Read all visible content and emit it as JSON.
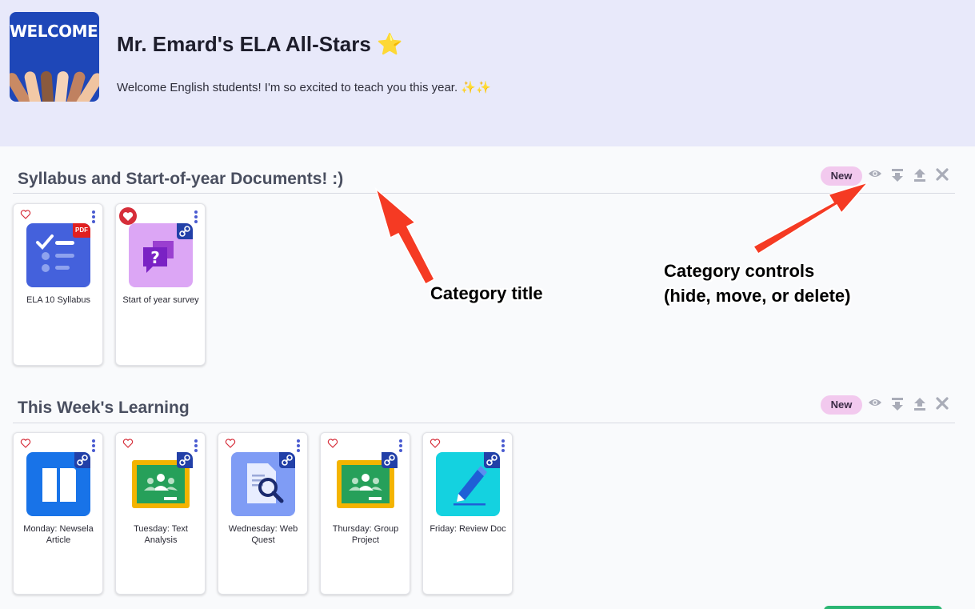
{
  "header": {
    "banner_text": "WELCOME!",
    "title": "Mr. Emard's ELA All-Stars ⭐",
    "description": "Welcome English students! I'm so excited to teach you this year. ✨✨"
  },
  "sections": [
    {
      "title": "Syllabus and Start-of-year Documents! :)",
      "new_label": "New",
      "items": [
        {
          "label": "ELA 10 Syllabus",
          "badge": "PDF"
        },
        {
          "label": "Start of year survey",
          "badge": "link"
        }
      ]
    },
    {
      "title": "This Week's Learning",
      "new_label": "New",
      "items": [
        {
          "label": "Monday: Newsela Article",
          "badge": "link"
        },
        {
          "label": "Tuesday: Text Analysis",
          "badge": "link"
        },
        {
          "label": "Wednesday: Web Quest",
          "badge": "link"
        },
        {
          "label": "Thursday: Group Project",
          "badge": "link"
        },
        {
          "label": "Friday: Review Doc",
          "badge": "link"
        }
      ]
    }
  ],
  "annotations": {
    "category_title": "Category title",
    "category_controls_line1": "Category controls",
    "category_controls_line2": "(hide, move, or delete)"
  },
  "icons": {
    "controls": [
      "eye-icon",
      "move-down-icon",
      "move-up-icon",
      "close-icon"
    ],
    "heart": "heart-icon",
    "menu": "kebab-menu-icon"
  },
  "colors": {
    "header_bg": "#e8e9fa",
    "badge_new_bg": "#f2c9ee",
    "arrow": "#f53a23",
    "heart": "#d62e3a",
    "link_badge": "#2240a8"
  }
}
